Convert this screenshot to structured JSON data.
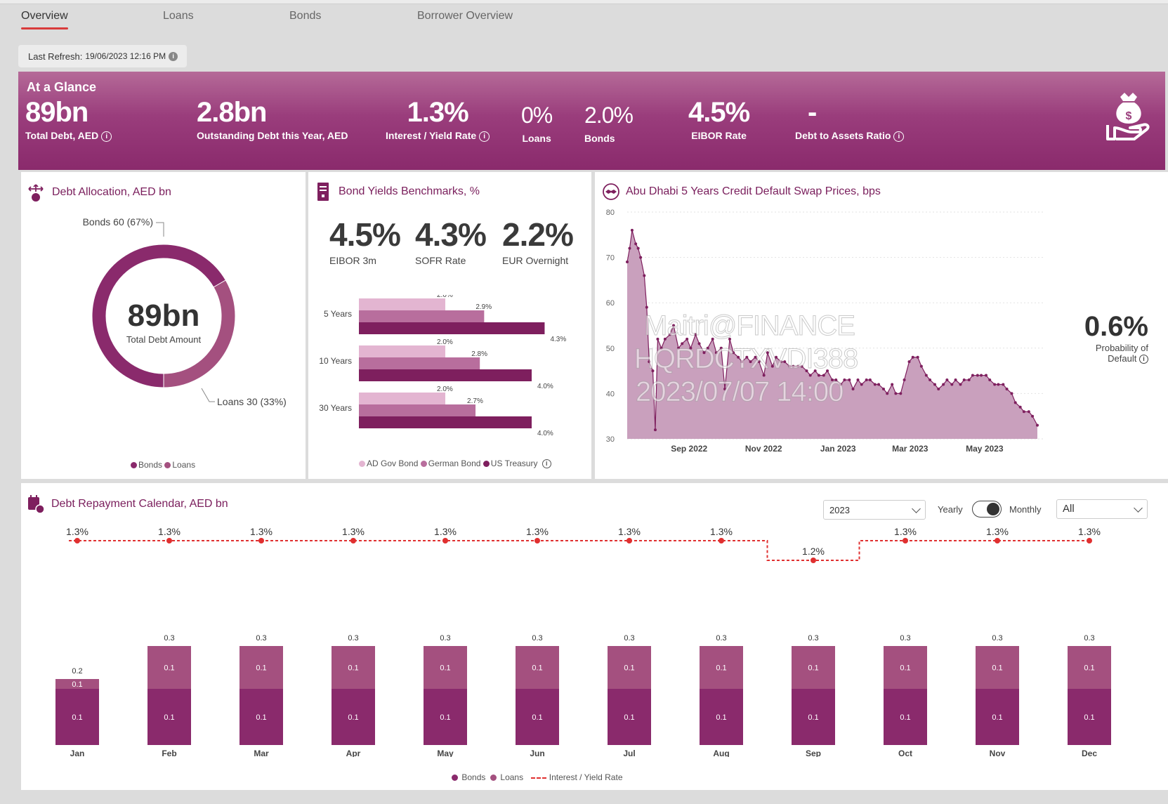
{
  "tabs": [
    {
      "label": "Overview",
      "active": true
    },
    {
      "label": "Loans",
      "active": false
    },
    {
      "label": "Bonds",
      "active": false
    },
    {
      "label": "Borrower Overview",
      "active": false
    }
  ],
  "refresh": {
    "label": "Last Refresh:",
    "value": "19/06/2023 12:16 PM"
  },
  "glance": {
    "title": "At a Glance",
    "kpis": [
      {
        "value": "89bn",
        "label": "Total Debt, AED",
        "info": true
      },
      {
        "value": "2.8bn",
        "label": "Outstanding Debt this Year, AED",
        "info": false
      },
      {
        "value": "1.3%",
        "label": "Interest / Yield Rate",
        "info": true
      },
      {
        "value": "0%",
        "label": "Loans",
        "info": false
      },
      {
        "value": "2.0%",
        "label": "Bonds",
        "info": false
      },
      {
        "value": "4.5%",
        "label": "EIBOR Rate",
        "info": false
      },
      {
        "value": "-",
        "label": "Debt to Assets Ratio",
        "info": true
      }
    ],
    "icon": "money-bag-hand-icon"
  },
  "colors": {
    "bonds": "#8a2a6c",
    "loans": "#a4507f",
    "ad_gov": "#e3b5d1",
    "german": "#b86e9d",
    "us": "#7e1f5e",
    "rate_line": "#e03030",
    "area": "#c9a0bd"
  },
  "allocation": {
    "title": "Debt Allocation, AED bn",
    "center_value": "89bn",
    "center_label": "Total Debt Amount",
    "bonds_label": "Bonds 60 (67%)",
    "loans_label": "Loans 30 (33%)",
    "legend": [
      "Bonds",
      "Loans"
    ]
  },
  "benchmarks": {
    "title": "Bond Yields Benchmarks, %",
    "headline": [
      {
        "value": "4.5%",
        "label": "EIBOR 3m"
      },
      {
        "value": "4.3%",
        "label": "SOFR Rate"
      },
      {
        "value": "2.2%",
        "label": "EUR Overnight"
      }
    ],
    "legend": [
      "AD Gov Bond",
      "German Bond",
      "US Treasury"
    ]
  },
  "cds": {
    "title": "Abu Dhabi 5 Years Credit Default Swap Prices, bps",
    "pod_value": "0.6%",
    "pod_label": "Probability of Default",
    "watermark": [
      "Maitri@FINANCE",
      "HQRDCTXVDI388",
      "2023/07/07 14:00"
    ]
  },
  "calendar": {
    "title": "Debt Repayment Calendar, AED bn",
    "year": "2023",
    "toggle_left": "Yearly",
    "toggle_right": "Monthly",
    "filter": "All",
    "legend": [
      "Bonds",
      "Loans",
      "Interest / Yield Rate"
    ]
  },
  "chart_data": [
    {
      "type": "pie",
      "title": "Debt Allocation, AED bn",
      "categories": [
        "Bonds",
        "Loans"
      ],
      "values": [
        60,
        30
      ],
      "percent": [
        67,
        33
      ]
    },
    {
      "type": "bar",
      "orientation": "horizontal",
      "categories": [
        "5 Years",
        "10 Years",
        "30 Years"
      ],
      "series": [
        {
          "name": "AD Gov Bond",
          "values": [
            2.0,
            2.0,
            2.0
          ]
        },
        {
          "name": "German Bond",
          "values": [
            2.9,
            2.8,
            2.7
          ]
        },
        {
          "name": "US Treasury",
          "values": [
            4.3,
            4.0,
            4.0
          ]
        }
      ],
      "xlim": [
        0,
        4.3
      ]
    },
    {
      "type": "area",
      "title": "Abu Dhabi 5 Years Credit Default Swap Prices, bps",
      "x_ticks": [
        "Sep 2022",
        "Nov 2022",
        "Jan 2023",
        "Mar 2023",
        "May 2023"
      ],
      "ylim": [
        30,
        80
      ],
      "y_ticks": [
        30,
        40,
        50,
        60,
        70,
        80
      ],
      "grid": true,
      "x": [
        "2022-07-18",
        "2022-07-20",
        "2022-07-22",
        "2022-07-25",
        "2022-07-27",
        "2022-07-29",
        "2022-08-01",
        "2022-08-03",
        "2022-08-05",
        "2022-08-08",
        "2022-08-10",
        "2022-08-12",
        "2022-08-15",
        "2022-08-18",
        "2022-08-22",
        "2022-08-25",
        "2022-08-29",
        "2022-09-01",
        "2022-09-05",
        "2022-09-08",
        "2022-09-12",
        "2022-09-15",
        "2022-09-19",
        "2022-09-22",
        "2022-09-26",
        "2022-09-29",
        "2022-10-03",
        "2022-10-06",
        "2022-10-10",
        "2022-10-13",
        "2022-10-17",
        "2022-10-20",
        "2022-10-24",
        "2022-10-27",
        "2022-10-31",
        "2022-11-03",
        "2022-11-07",
        "2022-11-10",
        "2022-11-14",
        "2022-11-17",
        "2022-11-21",
        "2022-11-24",
        "2022-11-28",
        "2022-12-01",
        "2022-12-05",
        "2022-12-08",
        "2022-12-12",
        "2022-12-15",
        "2022-12-19",
        "2022-12-22",
        "2022-12-26",
        "2022-12-29",
        "2023-01-02",
        "2023-01-05",
        "2023-01-09",
        "2023-01-12",
        "2023-01-16",
        "2023-01-19",
        "2023-01-23",
        "2023-01-26",
        "2023-01-30",
        "2023-02-02",
        "2023-02-06",
        "2023-02-09",
        "2023-02-13",
        "2023-02-16",
        "2023-02-20",
        "2023-02-23",
        "2023-02-27",
        "2023-03-02",
        "2023-03-06",
        "2023-03-09",
        "2023-03-13",
        "2023-03-16",
        "2023-03-20",
        "2023-03-23",
        "2023-03-27",
        "2023-03-30",
        "2023-04-03",
        "2023-04-06",
        "2023-04-10",
        "2023-04-13",
        "2023-04-17",
        "2023-04-20",
        "2023-04-24",
        "2023-04-27",
        "2023-05-01",
        "2023-05-04",
        "2023-05-08",
        "2023-05-11",
        "2023-05-15",
        "2023-05-18",
        "2023-05-22",
        "2023-05-25",
        "2023-05-29",
        "2023-06-01",
        "2023-06-05",
        "2023-06-08",
        "2023-06-12",
        "2023-06-15",
        "2023-06-19"
      ],
      "y": [
        69,
        72,
        76,
        73,
        72,
        70,
        66,
        59,
        47,
        45,
        32,
        52,
        50,
        52,
        53,
        55,
        50,
        51,
        52,
        50,
        53,
        51,
        49,
        50,
        52,
        49,
        50,
        41,
        52,
        49,
        48,
        47,
        48,
        47,
        48,
        47,
        44,
        49,
        46,
        48,
        47,
        47,
        46,
        46,
        46,
        46,
        45,
        44,
        45,
        44,
        44,
        45,
        43,
        43,
        42,
        43,
        43,
        41,
        43,
        42,
        43,
        43,
        42,
        42,
        41,
        40,
        42,
        40,
        40,
        43,
        47,
        48,
        48,
        46,
        44,
        43,
        42,
        41,
        42,
        43,
        42,
        43,
        42,
        43,
        43,
        44,
        44,
        44,
        44,
        43,
        42,
        42,
        42,
        41,
        40,
        38,
        37,
        36,
        36,
        35,
        33
      ]
    },
    {
      "type": "bar",
      "stacked": true,
      "title": "Debt Repayment Calendar, AED bn",
      "categories": [
        "Jan",
        "Feb",
        "Mar",
        "Apr",
        "May",
        "Jun",
        "Jul",
        "Aug",
        "Sep",
        "Oct",
        "Nov",
        "Dec"
      ],
      "series": [
        {
          "name": "Bonds",
          "values": [
            0.1,
            0.1,
            0.1,
            0.1,
            0.1,
            0.1,
            0.1,
            0.1,
            0.1,
            0.1,
            0.1,
            0.1
          ]
        },
        {
          "name": "Loans",
          "values": [
            0.1,
            0.1,
            0.1,
            0.1,
            0.1,
            0.1,
            0.1,
            0.1,
            0.1,
            0.1,
            0.1,
            0.1
          ]
        }
      ],
      "totals": [
        0.2,
        0.3,
        0.3,
        0.3,
        0.3,
        0.3,
        0.3,
        0.3,
        0.3,
        0.3,
        0.3,
        0.3
      ],
      "line": {
        "name": "Interest / Yield Rate",
        "values": [
          1.3,
          1.3,
          1.3,
          1.3,
          1.3,
          1.3,
          1.3,
          1.3,
          1.2,
          1.3,
          1.3,
          1.3
        ],
        "labels": [
          "1.3%",
          "1.3%",
          "1.3%",
          "1.3%",
          "1.3%",
          "1.3%",
          "1.3%",
          "1.3%",
          "1.2%",
          "1.3%",
          "1.3%",
          "1.3%"
        ]
      }
    }
  ]
}
